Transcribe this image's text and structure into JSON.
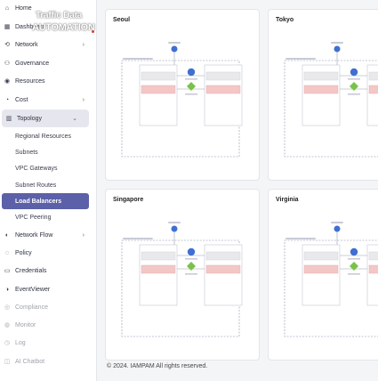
{
  "logo": {
    "line1": "Traffic Data",
    "line2": "AUTOMATION"
  },
  "sidebar": {
    "items": [
      {
        "label": "Home",
        "icon": "home-icon",
        "glyph": "⌂"
      },
      {
        "label": "Dashboard",
        "icon": "dashboard-icon",
        "glyph": "▦"
      },
      {
        "label": "Network",
        "icon": "network-icon",
        "glyph": "⟲",
        "chevron": "›"
      },
      {
        "label": "Governance",
        "icon": "governance-icon",
        "glyph": "⚇"
      },
      {
        "label": "Resources",
        "icon": "resources-icon",
        "glyph": "◉"
      },
      {
        "label": "Cost",
        "icon": "cost-icon",
        "glyph": "◔",
        "chevron": "›"
      },
      {
        "label": "Topology",
        "icon": "topology-icon",
        "glyph": "▥",
        "chevron": "⌄"
      }
    ],
    "topology_children": [
      "Regional Resources",
      "Subnets",
      "VPC Gateways",
      "Subnet Routes",
      "Load Balancers",
      "VPC Peering"
    ],
    "items_after": [
      {
        "label": "Network Flow",
        "icon": "network-flow-icon",
        "glyph": "◐",
        "chevron": "›"
      },
      {
        "label": "Policy",
        "icon": "policy-icon",
        "glyph": "◌"
      },
      {
        "label": "Credentials",
        "icon": "credentials-icon",
        "glyph": "▭"
      },
      {
        "label": "EventViewer",
        "icon": "event-viewer-icon",
        "glyph": "◑"
      },
      {
        "label": "Compliance",
        "icon": "compliance-icon",
        "glyph": "◎"
      },
      {
        "label": "Monitor",
        "icon": "monitor-icon",
        "glyph": "◍"
      },
      {
        "label": "Log",
        "icon": "log-icon",
        "glyph": "◷"
      },
      {
        "label": "AI Chatbot",
        "icon": "ai-chatbot-icon",
        "glyph": "◫"
      }
    ]
  },
  "regions": [
    {
      "name": "Seoul"
    },
    {
      "name": "Tokyo"
    },
    {
      "name": "Singapore"
    },
    {
      "name": "Virginia"
    }
  ],
  "colors": {
    "selected": "#5b60a8",
    "node_blue": "#3f6fd1",
    "node_green": "#79c24a",
    "box_pink": "#f4c7c7",
    "box_grey": "#e9e9ec",
    "dashed": "#8a90a8"
  },
  "footer": {
    "text": "© 2024. IAMPAM All rights reserved."
  }
}
